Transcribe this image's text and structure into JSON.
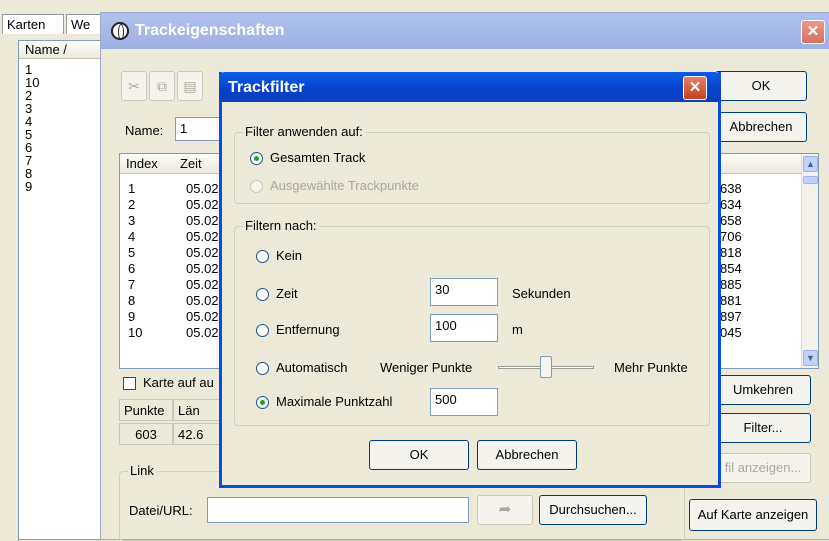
{
  "main": {
    "tabs": [
      "Karten",
      "We"
    ],
    "list_header": "Name  /",
    "list_items": [
      "1",
      "10",
      "2",
      "3",
      "4",
      "5",
      "6",
      "7",
      "8",
      "9"
    ]
  },
  "track_properties": {
    "title": "Trackeigenschaften",
    "close_glyph": "✕",
    "ok_label": "OK",
    "cancel_label": "Abbrechen",
    "name_label": "Name:",
    "name_value": "1",
    "table": {
      "col_index": "Index",
      "col_time": "Zeit",
      "rows": [
        {
          "index": "1",
          "time": "05.02",
          "tail": "638"
        },
        {
          "index": "2",
          "time": "05.02",
          "tail": "634"
        },
        {
          "index": "3",
          "time": "05.02",
          "tail": "658"
        },
        {
          "index": "4",
          "time": "05.02",
          "tail": "706"
        },
        {
          "index": "5",
          "time": "05.02",
          "tail": "818"
        },
        {
          "index": "6",
          "time": "05.02",
          "tail": "854"
        },
        {
          "index": "7",
          "time": "05.02",
          "tail": "885"
        },
        {
          "index": "8",
          "time": "05.02",
          "tail": "881"
        },
        {
          "index": "9",
          "time": "05.02",
          "tail": "897"
        },
        {
          "index": "10",
          "time": "05.02",
          "tail": "045"
        }
      ]
    },
    "karte_checkbox_label": "Karte auf au",
    "stats": {
      "points_header": "Punkte",
      "length_header": "Län",
      "points_value": "603",
      "length_value": "42.6"
    },
    "reverse_label": "Umkehren",
    "filter_label": "Filter...",
    "profile_label": "fil anzeigen...",
    "link_group_label": "Link",
    "file_url_label": "Datei/URL:",
    "file_url_value": "",
    "browse_label": "Durchsuchen...",
    "show_on_map_label": "Auf Karte anzeigen"
  },
  "filter_dialog": {
    "title": "Trackfilter",
    "close_glyph": "✕",
    "apply_group_label": "Filter anwenden auf:",
    "apply_options": [
      {
        "label": "Gesamten Track",
        "checked": true,
        "disabled": false
      },
      {
        "label": "Ausgewählte Trackpunkte",
        "checked": false,
        "disabled": true
      }
    ],
    "filter_group_label": "Filtern nach:",
    "filter_options": {
      "none": "Kein",
      "time": "Zeit",
      "distance": "Entfernung",
      "auto": "Automatisch",
      "max_points": "Maximale Punktzahl"
    },
    "selected_filter": "max_points",
    "time_value": "30",
    "time_unit": "Sekunden",
    "distance_value": "100",
    "distance_unit": "m",
    "fewer_points_label": "Weniger Punkte",
    "more_points_label": "Mehr Punkte",
    "slider_level": 0.5,
    "max_points_value": "500",
    "ok_label": "OK",
    "cancel_label": "Abbrechen"
  },
  "colors": {
    "window_bg": "#ece9d8",
    "active_title": "#0a4ce0",
    "inactive_title": "#9db0e2",
    "close_red": "#c5401f",
    "radio_check": "#21a121"
  }
}
